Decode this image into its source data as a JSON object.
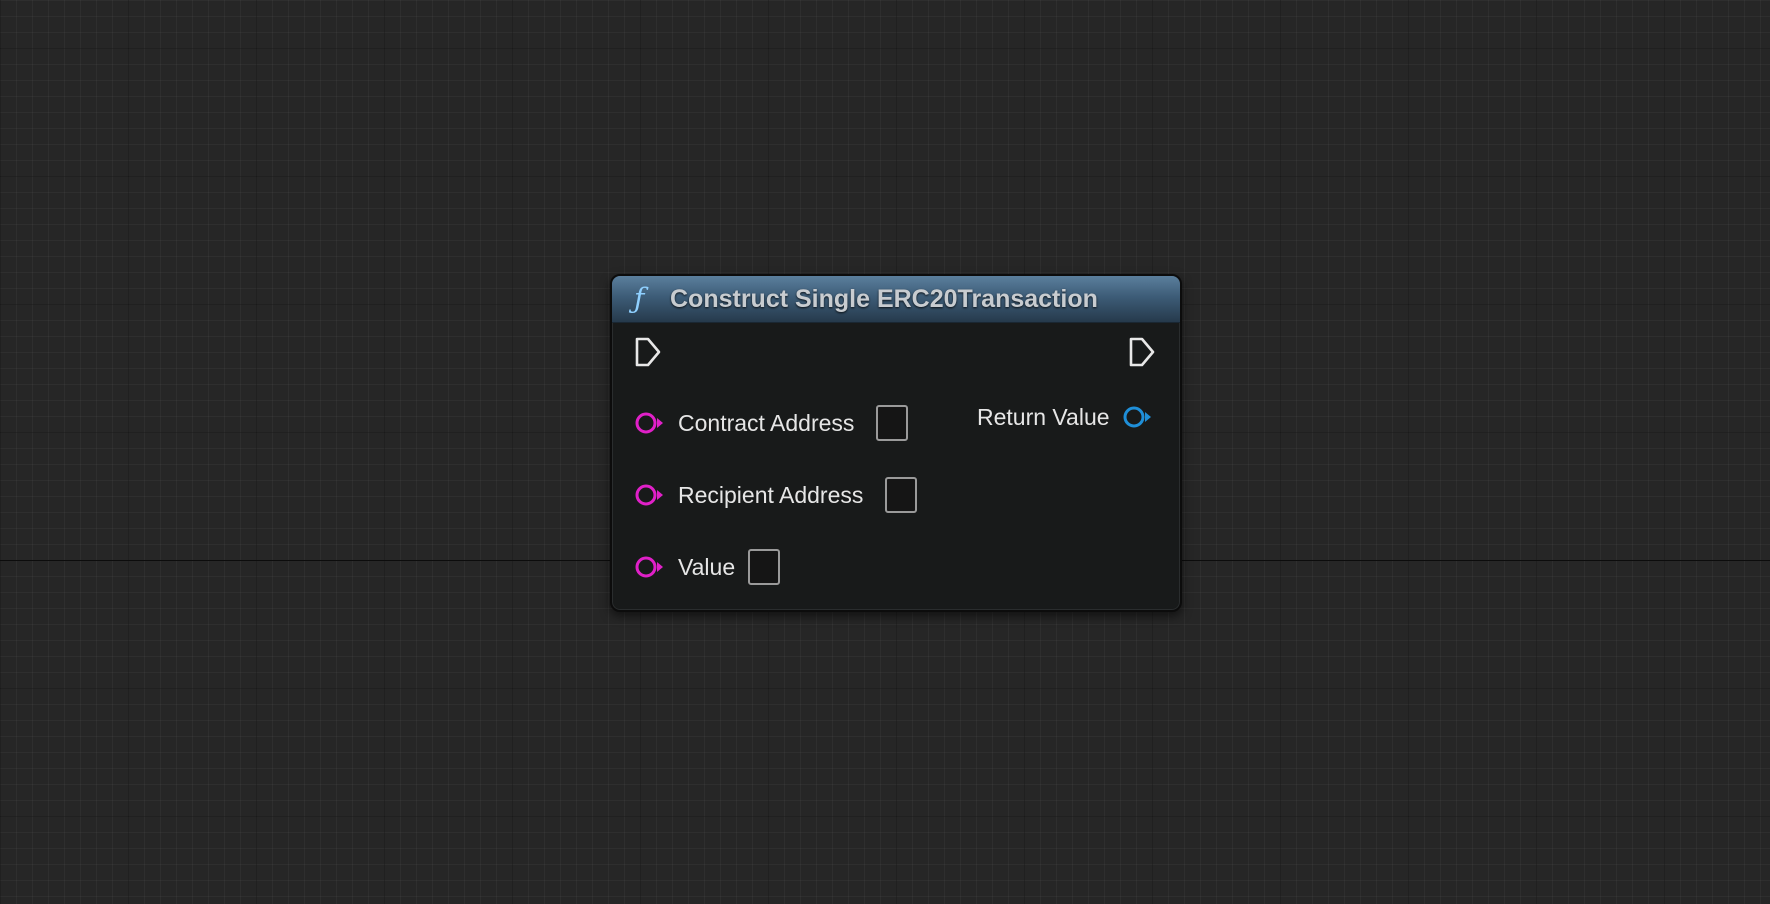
{
  "graph": {
    "name": "blueprint-graph"
  },
  "node": {
    "title": "Construct Single ERC20Transaction",
    "icon": "function-icon",
    "icon_glyph": "ƒ",
    "header_color": "#4a6a86",
    "inputs": [
      {
        "label": "Contract Address",
        "type": "string",
        "color": "#e020c8"
      },
      {
        "label": "Recipient Address",
        "type": "string",
        "color": "#e020c8"
      },
      {
        "label": "Value",
        "type": "string",
        "color": "#e020c8"
      }
    ],
    "outputs": [
      {
        "label": "Return Value",
        "type": "struct",
        "color": "#1f8fd8"
      }
    ]
  }
}
